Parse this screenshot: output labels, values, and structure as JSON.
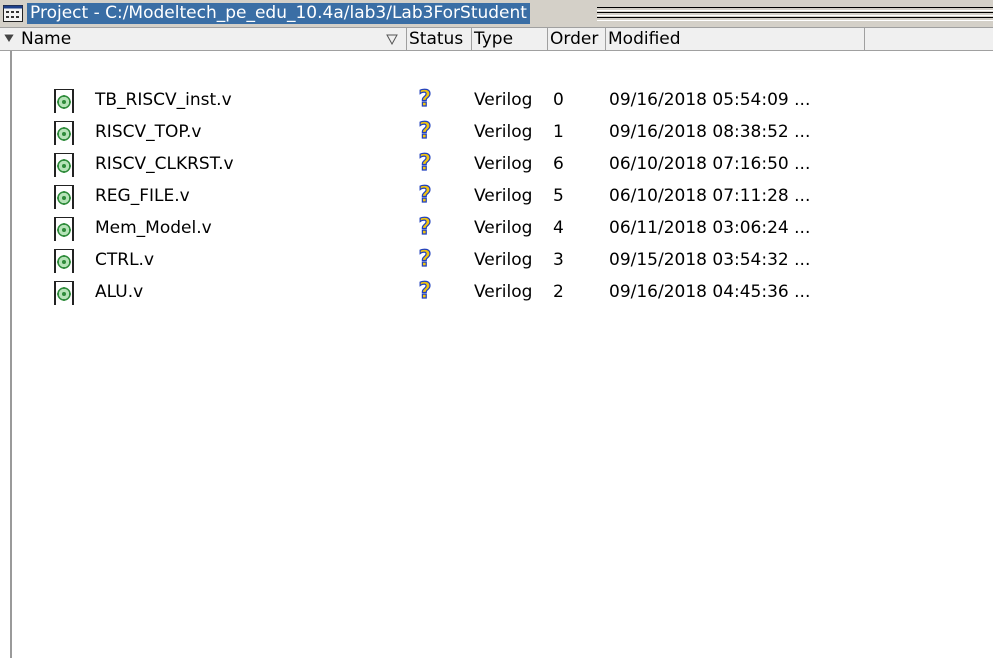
{
  "window": {
    "title": "Project - C:/Modeltech_pe_edu_10.4a/lab3/Lab3ForStudent"
  },
  "columns": {
    "name": "Name",
    "status": "Status",
    "type": "Type",
    "order": "Order",
    "modified": "Modified"
  },
  "files": [
    {
      "name": "TB_RISCV_inst.v",
      "type": "Verilog",
      "order": "0",
      "modified": "09/16/2018 05:54:09 ..."
    },
    {
      "name": "RISCV_TOP.v",
      "type": "Verilog",
      "order": "1",
      "modified": "09/16/2018 08:38:52 ..."
    },
    {
      "name": "RISCV_CLKRST.v",
      "type": "Verilog",
      "order": "6",
      "modified": "06/10/2018 07:16:50 ..."
    },
    {
      "name": "REG_FILE.v",
      "type": "Verilog",
      "order": "5",
      "modified": "06/10/2018 07:11:28 ..."
    },
    {
      "name": "Mem_Model.v",
      "type": "Verilog",
      "order": "4",
      "modified": "06/11/2018 03:06:24 ..."
    },
    {
      "name": "CTRL.v",
      "type": "Verilog",
      "order": "3",
      "modified": "09/15/2018 03:54:32 ..."
    },
    {
      "name": "ALU.v",
      "type": "Verilog",
      "order": "2",
      "modified": "09/16/2018 04:45:36 ..."
    }
  ],
  "icons": {
    "window": "project-icon",
    "file": "verilog-file-icon",
    "status": "question-mark-icon",
    "sort": "sort-down-icon",
    "filter": "filter-icon"
  },
  "colors": {
    "title_highlight": "#3a6ea5",
    "status_icon": "#1f3fbf",
    "file_icon_green": "#2e8b3a"
  }
}
